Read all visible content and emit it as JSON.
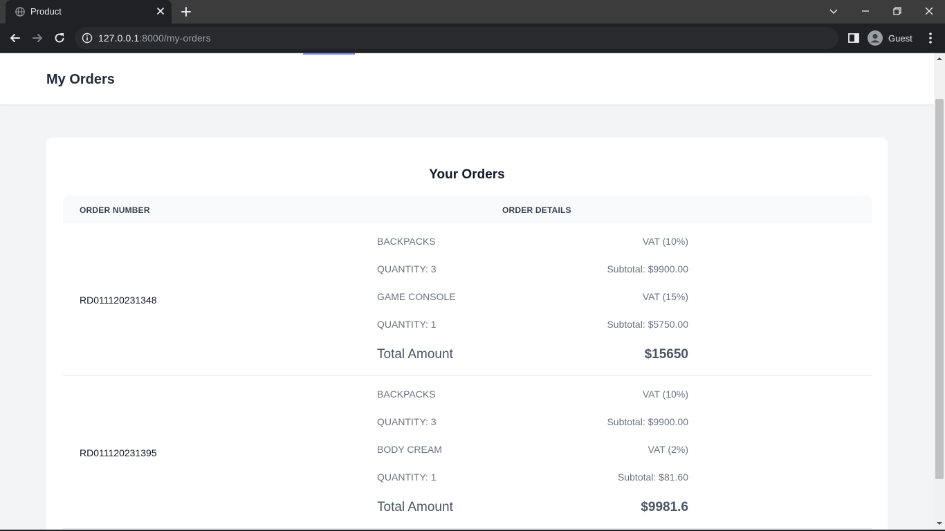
{
  "browser": {
    "tab_title": "Product",
    "url_host": "127.0.0.1",
    "url_path": ":8000/my-orders",
    "profile_label": "Guest"
  },
  "page": {
    "header_title": "My Orders",
    "card_title": "Your Orders",
    "columns": [
      "ORDER NUMBER",
      "ORDER DETAILS"
    ]
  },
  "orders": [
    {
      "number": "RD011120231348",
      "items": [
        {
          "name": "BACKPACKS",
          "vat": "VAT (10%)",
          "quantity": "QUANTITY: 3",
          "subtotal": "Subtotal: $9900.00"
        },
        {
          "name": "GAME CONSOLE",
          "vat": "VAT (15%)",
          "quantity": "QUANTITY: 1",
          "subtotal": "Subtotal: $5750.00"
        }
      ],
      "total_label": "Total Amount",
      "total_value": "$15650"
    },
    {
      "number": "RD011120231395",
      "items": [
        {
          "name": "BACKPACKS",
          "vat": "VAT (10%)",
          "quantity": "QUANTITY: 3",
          "subtotal": "Subtotal: $9900.00"
        },
        {
          "name": "BODY CREAM",
          "vat": "VAT (2%)",
          "quantity": "QUANTITY: 1",
          "subtotal": "Subtotal: $81.60"
        }
      ],
      "total_label": "Total Amount",
      "total_value": "$9981.6"
    }
  ],
  "colors": {
    "accent_underline": "#818cf8",
    "page_background": "#f3f4f6",
    "card_background": "#ffffff"
  },
  "icons": [
    "globe-icon",
    "close-icon",
    "plus-icon",
    "chevron-down-icon",
    "minimize-icon",
    "restore-icon",
    "back-arrow-icon",
    "forward-arrow-icon",
    "reload-icon",
    "info-icon",
    "side-panel-icon",
    "profile-avatar-icon",
    "kebab-menu-icon"
  ]
}
